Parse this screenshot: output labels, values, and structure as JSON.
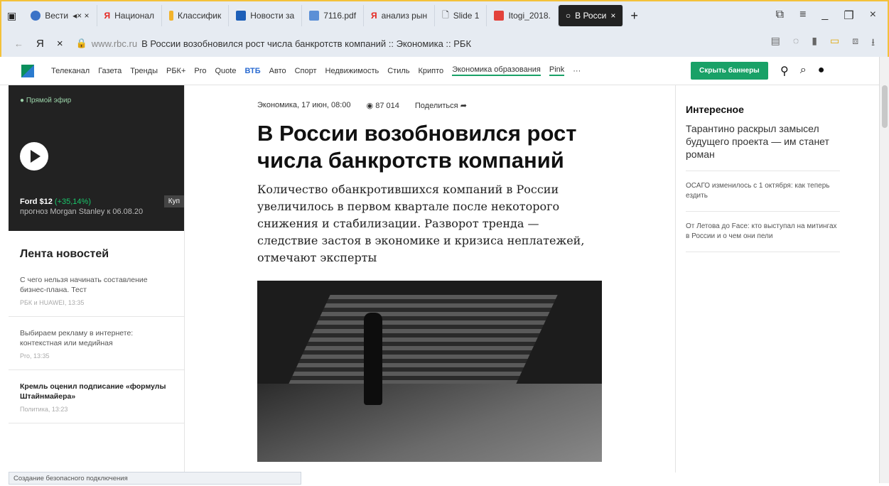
{
  "tabs": [
    {
      "label": "Вести",
      "color": "#3b73c7"
    },
    {
      "label": "Национал",
      "color": "#e52620"
    },
    {
      "label": "Классифик",
      "color": "#f2b32b"
    },
    {
      "label": "Новости за",
      "color": "#1d5fb8"
    },
    {
      "label": "7116.pdf",
      "color": "#5b8fd6"
    },
    {
      "label": "анализ рын",
      "color": "#e52620"
    },
    {
      "label": "Slide 1",
      "color": "#999999"
    },
    {
      "label": "Itogi_2018.",
      "color": "#e3423b"
    },
    {
      "label": "В Росси",
      "color": "#ffffff",
      "active": true
    }
  ],
  "address": {
    "host": "www.rbc.ru",
    "page_title": "В России возобновился рост числа банкротств компаний :: Экономика :: РБК"
  },
  "nav": {
    "items": [
      "Телеканал",
      "Газета",
      "Тренды",
      "РБК+",
      "Pro",
      "Quote",
      "ВТБ",
      "Авто",
      "Спорт",
      "Недвижимость",
      "Стиль",
      "Крипто",
      "Экономика образования",
      "Pink",
      "···"
    ],
    "hide_banners": "Скрыть баннеры"
  },
  "live": {
    "onair": "● Прямой эфир",
    "ticker": "Ford $12",
    "ticker_change": "(+35,14%)",
    "forecast": "прогноз Morgan Stanley к 06.08.20",
    "buy": "Куп"
  },
  "feed": {
    "title": "Лента новостей",
    "items": [
      {
        "text": "С чего нельзя начинать составление бизнес-плана. Тест",
        "meta": "РБК и HUAWEI, 13:35"
      },
      {
        "text": "Выбираем рекламу в интернете: контекстная или медийная",
        "meta": "Pro, 13:35"
      },
      {
        "text": "Кремль оценил подписание «формулы Штайнмайера»",
        "meta": "Политика, 13:23"
      }
    ]
  },
  "article": {
    "section_date": "Экономика, 17 июн, 08:00",
    "views": "87 014",
    "share": "Поделиться",
    "title": "В России возобновился рост числа банкротств компаний",
    "lead": "Количество обанкротившихся компаний в России увеличилось в первом квартале после некоторого снижения и стабилизации. Разворот тренда — следствие застоя в экономике и кризиса неплатежей, отмечают эксперты"
  },
  "right": {
    "title": "Интересное",
    "big": "Тарантино раскрыл замысел будущего проекта — им станет роман",
    "items": [
      "ОСАГО изменилось с 1 октября: как теперь ездить",
      "От Летова до Face: кто выступал на митингах в России и о чем они пели"
    ]
  },
  "status": "Создание безопасного подключения"
}
